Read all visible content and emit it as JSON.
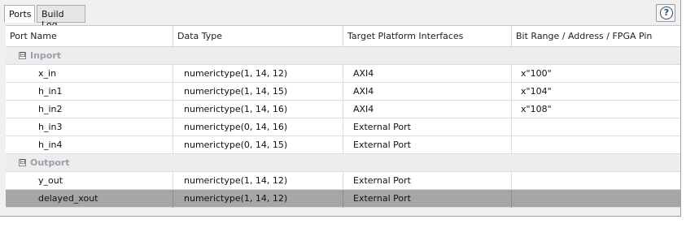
{
  "tabs": [
    {
      "label": "Ports",
      "active": true
    },
    {
      "label": "Build Log",
      "active": false
    }
  ],
  "help": {
    "label": "?"
  },
  "columns": [
    "Port Name",
    "Data Type",
    "Target Platform Interfaces",
    "Bit Range / Address / FPGA Pin"
  ],
  "groups": [
    {
      "label": "Inport",
      "expander": "⊟",
      "rows": [
        {
          "name": "x_in",
          "type": "numerictype(1, 14, 12)",
          "interface": "AXI4",
          "range": "x\"100\"",
          "selected": false
        },
        {
          "name": "h_in1",
          "type": "numerictype(1, 14, 15)",
          "interface": "AXI4",
          "range": "x\"104\"",
          "selected": false
        },
        {
          "name": "h_in2",
          "type": "numerictype(1, 14, 16)",
          "interface": "AXI4",
          "range": "x\"108\"",
          "selected": false
        },
        {
          "name": "h_in3",
          "type": "numerictype(0, 14, 16)",
          "interface": "External Port",
          "range": "",
          "selected": false
        },
        {
          "name": "h_in4",
          "type": "numerictype(0, 14, 15)",
          "interface": "External Port",
          "range": "",
          "selected": false
        }
      ]
    },
    {
      "label": "Outport",
      "expander": "⊟",
      "rows": [
        {
          "name": "y_out",
          "type": "numerictype(1, 14, 12)",
          "interface": "External Port",
          "range": "",
          "selected": false
        },
        {
          "name": "delayed_xout",
          "type": "numerictype(1, 14, 12)",
          "interface": "External Port",
          "range": "",
          "selected": true
        }
      ]
    }
  ],
  "colors": {
    "selected_row": "#a6a6a6",
    "group_row": "#ededed",
    "group_label": "#9aa0aa"
  }
}
